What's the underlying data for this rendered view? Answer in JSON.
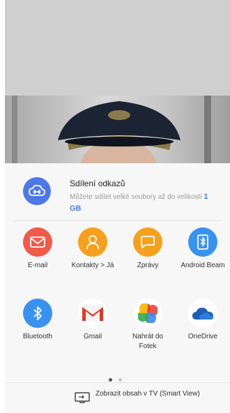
{
  "share": {
    "title": "Sdílení odkazů",
    "description": "Můžete sdílet velké soubory až do velikosti",
    "size": "1 GB",
    "size_suffix": ".",
    "icon": "cloud-link-icon"
  },
  "apps": [
    {
      "label": "E-mail",
      "icon": "email-icon",
      "color": "#f05a4a"
    },
    {
      "label": "Kontakty > Já",
      "icon": "contact-icon",
      "color": "#f7a01e"
    },
    {
      "label": "Zprávy",
      "icon": "message-icon",
      "color": "#f7a01e"
    },
    {
      "label": "Android Beam",
      "icon": "android-beam-icon",
      "color": "#3a92ef"
    },
    {
      "label": "Bluetooth",
      "icon": "bluetooth-icon",
      "color": "#3a92ef"
    },
    {
      "label": "Gmail",
      "icon": "gmail-icon",
      "color": "#ffffff"
    },
    {
      "label": "Nahrát do Fotek",
      "icon": "google-photos-icon",
      "color": "#ffffff"
    },
    {
      "label": "OneDrive",
      "icon": "onedrive-icon",
      "color": "#ffffff"
    }
  ],
  "pagination": {
    "total": 2,
    "current": 1
  },
  "smart_view": {
    "label": "Zobrazit obsah v TV (Smart View)",
    "icon": "tv-cast-icon"
  },
  "background": {
    "top_color": "#cfcfcf"
  }
}
